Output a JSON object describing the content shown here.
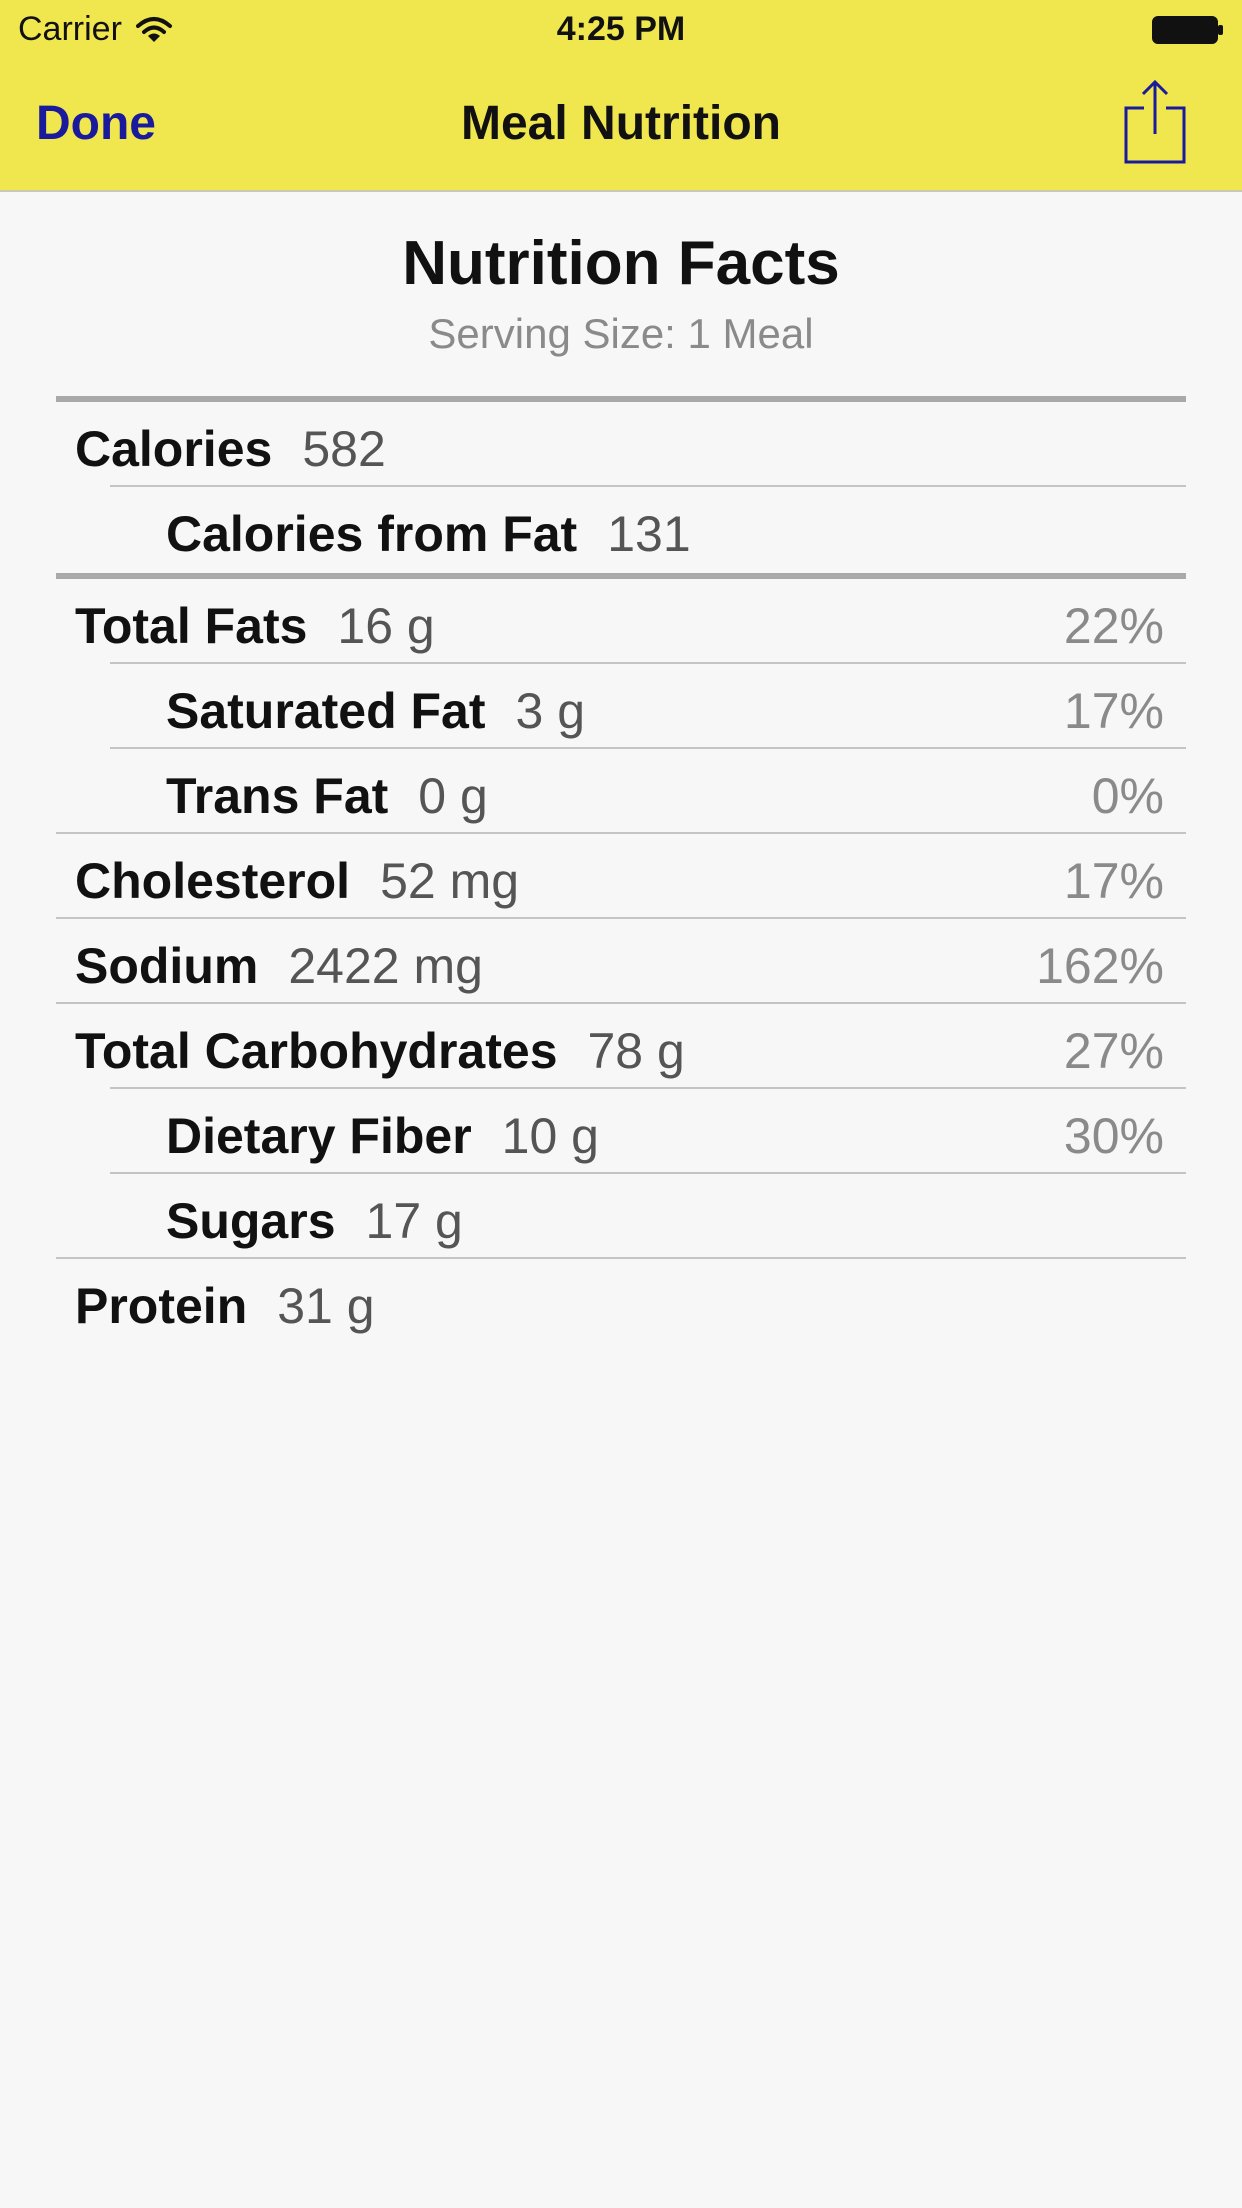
{
  "status_bar": {
    "carrier": "Carrier",
    "time": "4:25 PM"
  },
  "nav": {
    "done_label": "Done",
    "title": "Meal Nutrition",
    "share_icon": "share-icon"
  },
  "nutrition": {
    "title": "Nutrition Facts",
    "serving_size": "Serving Size: 1 Meal",
    "rows": [
      {
        "name": "Calories",
        "amount": "582",
        "percent": ""
      },
      {
        "name": "Calories from Fat",
        "amount": "131",
        "percent": ""
      },
      {
        "name": "Total Fats",
        "amount": "16 g",
        "percent": "22%"
      },
      {
        "name": "Saturated Fat",
        "amount": "3 g",
        "percent": "17%"
      },
      {
        "name": "Trans Fat",
        "amount": "0 g",
        "percent": "0%"
      },
      {
        "name": "Cholesterol",
        "amount": "52 mg",
        "percent": "17%"
      },
      {
        "name": "Sodium",
        "amount": "2422 mg",
        "percent": "162%"
      },
      {
        "name": "Total Carbohydrates",
        "amount": "78 g",
        "percent": "27%"
      },
      {
        "name": "Dietary Fiber",
        "amount": "10 g",
        "percent": "30%"
      },
      {
        "name": "Sugars",
        "amount": "17 g",
        "percent": ""
      },
      {
        "name": "Protein",
        "amount": "31 g",
        "percent": ""
      }
    ]
  },
  "colors": {
    "header_bg": "#f0e74f",
    "accent": "#1a1a9c",
    "background": "#f7f7f7"
  }
}
